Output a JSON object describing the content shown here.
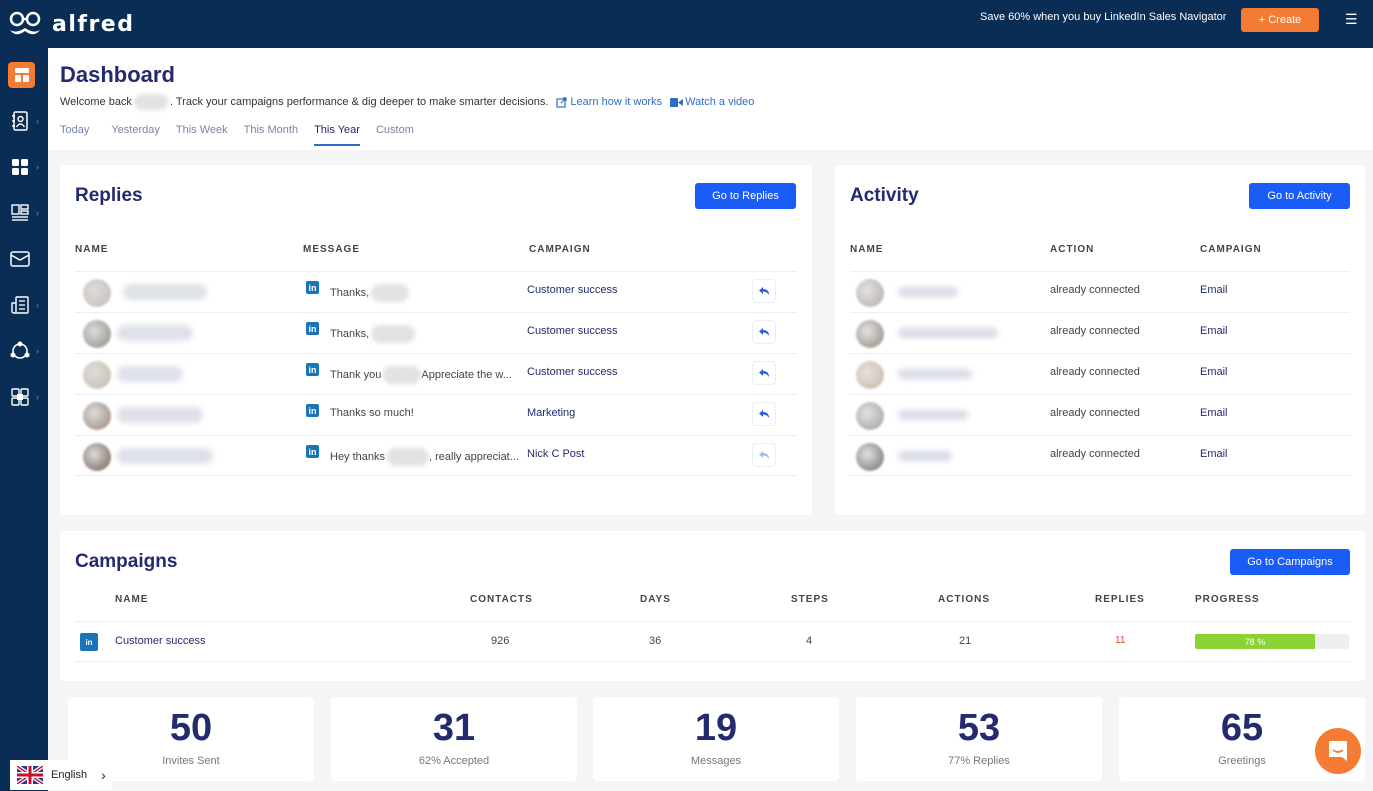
{
  "app": {
    "name": "alfred"
  },
  "topbar": {
    "promo": "Save 60% when you buy LinkedIn Sales Navigator",
    "create_label": "+ Create",
    "menu_icon": "☰"
  },
  "sidebar": {
    "items": [
      {
        "name": "dashboard",
        "active": true
      },
      {
        "name": "contacts"
      },
      {
        "name": "apps"
      },
      {
        "name": "templates"
      },
      {
        "name": "inbox"
      },
      {
        "name": "reports"
      },
      {
        "name": "support"
      },
      {
        "name": "integrations"
      }
    ]
  },
  "header": {
    "title": "Dashboard",
    "welcome_prefix": "Welcome back",
    "welcome_suffix": ". Track your campaigns performance & dig deeper to make smarter decisions.",
    "learn_link": "Learn how it works",
    "video_link": "Watch a video",
    "tabs": [
      "Today",
      "Yesterday",
      "This Week",
      "This Month",
      "This Year",
      "Custom"
    ],
    "active_tab": "This Year"
  },
  "replies": {
    "title": "Replies",
    "button": "Go to Replies",
    "columns": [
      "NAME",
      "MESSAGE",
      "CAMPAIGN"
    ],
    "rows": [
      {
        "message_pre": "Thanks,",
        "message_post": "",
        "campaign": "Customer success"
      },
      {
        "message_pre": "Thanks,",
        "message_post": "",
        "campaign": "Customer success"
      },
      {
        "message_pre": "Thank you",
        "message_post": "Appreciate the w...",
        "campaign": "Customer success"
      },
      {
        "message_pre": "Thanks so much!",
        "message_post": "",
        "campaign": "Marketing"
      },
      {
        "message_pre": "Hey thanks",
        "message_post": ", really appreciat...",
        "campaign": "Nick C Post"
      }
    ]
  },
  "activity": {
    "title": "Activity",
    "button": "Go to Activity",
    "columns": [
      "NAME",
      "ACTION",
      "CAMPAIGN"
    ],
    "rows": [
      {
        "action": "already connected",
        "campaign": "Email"
      },
      {
        "action": "already connected",
        "campaign": "Email"
      },
      {
        "action": "already connected",
        "campaign": "Email"
      },
      {
        "action": "already connected",
        "campaign": "Email"
      },
      {
        "action": "already connected",
        "campaign": "Email"
      }
    ]
  },
  "campaigns": {
    "title": "Campaigns",
    "button": "Go to Campaigns",
    "columns": [
      "NAME",
      "CONTACTS",
      "DAYS",
      "STEPS",
      "ACTIONS",
      "REPLIES",
      "PROGRESS"
    ],
    "rows": [
      {
        "name": "Customer success",
        "contacts": "926",
        "days": "36",
        "steps": "4",
        "actions": "21",
        "replies": "11",
        "progress_label": "78 %",
        "progress": 0.78
      }
    ]
  },
  "stats": [
    {
      "value": "50",
      "label": "Invites Sent"
    },
    {
      "value": "31",
      "label": "62% Accepted"
    },
    {
      "value": "19",
      "label": "Messages"
    },
    {
      "value": "53",
      "label": "77% Replies"
    },
    {
      "value": "65",
      "label": "Greetings"
    }
  ],
  "language": {
    "label": "English"
  },
  "colors": {
    "accent": "#f47b33",
    "primary": "#1a5cf6",
    "navy": "#0a2d55",
    "progress": "#8cd233",
    "replies_count": "#e0442b"
  }
}
